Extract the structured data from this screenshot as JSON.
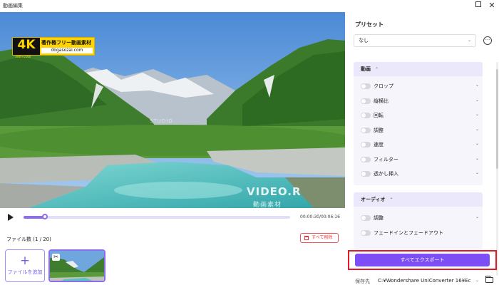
{
  "window": {
    "title": "動画編集"
  },
  "video": {
    "badge_big": "4K",
    "badge_small": "3840×2160",
    "badge_line1": "著作権フリー動画素材",
    "badge_line2": "dogasozai.com",
    "watermark_small": "STUDIO",
    "watermark_logo": "VIDEO.R",
    "watermark_sub": "動画素材"
  },
  "player": {
    "timecode": "00:00:30/00:06:16",
    "progress_fraction": 0.08
  },
  "files": {
    "count_label": "ファイル数 (1 / 20)",
    "delete_all": "すべて削除",
    "add_file": "ファイルを追加"
  },
  "panel": {
    "preset_label": "プリセット",
    "preset_value": "なし",
    "video_section": {
      "title": "動画",
      "items": [
        "クロップ",
        "縦横比",
        "回転",
        "調整",
        "速度",
        "フィルター",
        "透かし挿入"
      ]
    },
    "audio_section": {
      "title": "オーディオ",
      "items": [
        "調整",
        "フェードインとフェードアウト"
      ]
    },
    "export_all": "すべてエクスポート",
    "save_to_label": "保存先",
    "save_path": "C:¥Wondershare UniConverter 16¥Ec"
  },
  "colors": {
    "accent": "#7d4df6",
    "highlight": "#e1192b"
  }
}
